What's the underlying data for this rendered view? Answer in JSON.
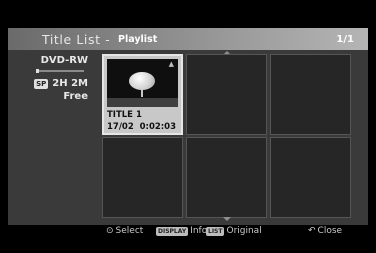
{
  "header": {
    "title": "Title List",
    "separator": "-",
    "subtitle": "Playlist",
    "page": "1/1"
  },
  "disc": {
    "type": "DVD-RW",
    "rec_mode": "SP",
    "remaining": "2H 2M",
    "free_label": "Free"
  },
  "titles": [
    {
      "name": "TITLE 1",
      "date": "17/02",
      "duration": "0:02:03"
    }
  ],
  "footer": {
    "select_label": "Select",
    "display_key": "DISPLAY",
    "info_label": "Info",
    "list_key": "LIST",
    "original_label": "Original",
    "close_label": "Close"
  },
  "colors": {
    "header_gradient_start": "#6a6a6a",
    "header_gradient_end": "#b5b5b5",
    "panel_bg": "#3a3a3a",
    "selected_cell": "#c8c8c8"
  }
}
